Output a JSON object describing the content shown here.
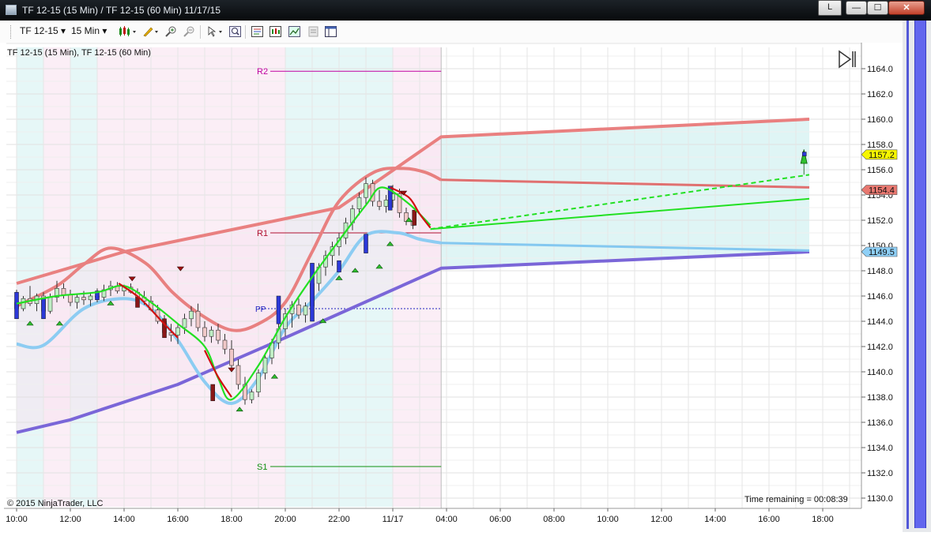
{
  "window": {
    "title": "TF 12-15 (15 Min) / TF 12-15 (60 Min)  11/17/15",
    "layout_button": "L",
    "minimize": "—",
    "maximize": "☐",
    "close": "✕"
  },
  "toolbar": {
    "instrument": "TF 12-15",
    "interval": "15 Min",
    "icons": [
      "candlestick-chart-icon",
      "pencil-icon",
      "zoom-in-icon",
      "zoom-out-icon",
      "cursor-icon",
      "magnify-icon",
      "data-box-icon",
      "indicators-icon",
      "strategies-icon",
      "properties-icon",
      "panel-icon"
    ]
  },
  "chart": {
    "label": "TF 12-15 (15 Min), TF 12-15 (60 Min)",
    "copyright": "© 2015 NinjaTrader, LLC",
    "time_remaining": "Time remaining = 00:08:39",
    "end_icon": "skip-to-end-icon"
  },
  "chart_data": {
    "type": "candlestick",
    "ylim": [
      1129,
      1166
    ],
    "y_ticks": [
      "1130.0",
      "1132.0",
      "1134.0",
      "1136.0",
      "1138.0",
      "1140.0",
      "1142.0",
      "1144.0",
      "1146.0",
      "1148.0",
      "1150.0",
      "1152.0",
      "1154.0",
      "1156.0",
      "1158.0",
      "1160.0",
      "1162.0",
      "1164.0"
    ],
    "x_ticks": [
      "10:00",
      "12:00",
      "14:00",
      "16:00",
      "18:00",
      "20:00",
      "22:00",
      "11/17",
      "04:00",
      "06:00",
      "08:00",
      "10:00",
      "12:00",
      "14:00",
      "16:00",
      "18:00"
    ],
    "price_tags": [
      {
        "value": 1157.2,
        "label": "1157.2",
        "color": "#f6f600"
      },
      {
        "value": 1154.4,
        "label": "1154.4",
        "color": "#e87870"
      },
      {
        "value": 1149.5,
        "label": "1149.5",
        "color": "#8ecff6"
      }
    ],
    "pivots": [
      {
        "name": "R2",
        "value": 1163.8,
        "color": "#c000a0"
      },
      {
        "name": "R1",
        "value": 1151.0,
        "color": "#b01030"
      },
      {
        "name": "PP",
        "value": 1145.0,
        "color": "#2020c0"
      },
      {
        "name": "S1",
        "value": 1132.5,
        "color": "#109010"
      }
    ],
    "candles_ohlc": [
      [
        1145.5,
        1146.5,
        1144.5,
        1145.0
      ],
      [
        1145.0,
        1146.0,
        1144.8,
        1145.8
      ],
      [
        1145.8,
        1146.8,
        1145.2,
        1145.4
      ],
      [
        1145.4,
        1146.2,
        1144.8,
        1146.0
      ],
      [
        1146.0,
        1146.3,
        1144.5,
        1144.8
      ],
      [
        1144.8,
        1146.2,
        1144.6,
        1145.9
      ],
      [
        1145.9,
        1147.2,
        1145.5,
        1146.6
      ],
      [
        1146.6,
        1147.0,
        1145.8,
        1146.1
      ],
      [
        1146.1,
        1146.5,
        1145.2,
        1145.5
      ],
      [
        1145.5,
        1146.2,
        1145.0,
        1145.9
      ],
      [
        1145.9,
        1146.4,
        1145.3,
        1145.7
      ],
      [
        1145.7,
        1146.3,
        1145.2,
        1146.0
      ],
      [
        1146.0,
        1146.6,
        1145.5,
        1145.9
      ],
      [
        1145.9,
        1146.9,
        1145.6,
        1146.5
      ],
      [
        1146.5,
        1147.2,
        1146.0,
        1146.8
      ],
      [
        1146.8,
        1147.1,
        1146.2,
        1146.4
      ],
      [
        1146.4,
        1146.9,
        1146.0,
        1146.7
      ],
      [
        1146.7,
        1147.0,
        1146.2,
        1146.3
      ],
      [
        1146.3,
        1146.6,
        1145.7,
        1145.9
      ],
      [
        1145.9,
        1146.4,
        1145.3,
        1145.6
      ],
      [
        1145.6,
        1146.0,
        1144.8,
        1144.9
      ],
      [
        1144.9,
        1145.3,
        1143.8,
        1144.0
      ],
      [
        1144.0,
        1144.5,
        1142.8,
        1143.1
      ],
      [
        1143.1,
        1143.8,
        1142.4,
        1142.9
      ],
      [
        1142.9,
        1143.8,
        1142.2,
        1143.5
      ],
      [
        1143.5,
        1144.6,
        1143.0,
        1144.2
      ],
      [
        1144.2,
        1145.2,
        1143.6,
        1144.8
      ],
      [
        1144.8,
        1145.4,
        1143.2,
        1143.5
      ],
      [
        1143.5,
        1144.0,
        1142.4,
        1142.8
      ],
      [
        1142.8,
        1143.6,
        1142.3,
        1143.3
      ],
      [
        1143.3,
        1143.8,
        1142.2,
        1142.5
      ],
      [
        1142.5,
        1143.0,
        1141.4,
        1141.8
      ],
      [
        1141.8,
        1142.5,
        1140.2,
        1140.5
      ],
      [
        1140.5,
        1141.0,
        1138.6,
        1139.0
      ],
      [
        1139.0,
        1139.6,
        1137.4,
        1137.8
      ],
      [
        1137.8,
        1138.6,
        1137.5,
        1138.4
      ],
      [
        1138.4,
        1140.2,
        1138.0,
        1139.9
      ],
      [
        1139.9,
        1141.4,
        1139.4,
        1141.1
      ],
      [
        1141.1,
        1142.6,
        1140.6,
        1142.3
      ],
      [
        1142.3,
        1143.8,
        1141.8,
        1143.4
      ],
      [
        1143.4,
        1145.0,
        1142.8,
        1144.6
      ],
      [
        1144.6,
        1145.6,
        1143.5,
        1145.3
      ],
      [
        1145.3,
        1145.8,
        1144.2,
        1144.5
      ],
      [
        1144.5,
        1145.5,
        1143.9,
        1145.2
      ],
      [
        1145.2,
        1147.5,
        1144.0,
        1147.0
      ],
      [
        1147.0,
        1148.6,
        1146.4,
        1148.3
      ],
      [
        1148.3,
        1149.6,
        1147.6,
        1149.2
      ],
      [
        1149.2,
        1150.3,
        1148.4,
        1149.9
      ],
      [
        1149.9,
        1151.0,
        1149.2,
        1150.6
      ],
      [
        1150.6,
        1152.2,
        1150.1,
        1151.8
      ],
      [
        1151.8,
        1153.2,
        1151.2,
        1152.9
      ],
      [
        1152.9,
        1154.2,
        1152.4,
        1153.8
      ],
      [
        1153.8,
        1155.4,
        1153.2,
        1154.9
      ],
      [
        1154.9,
        1155.2,
        1153.1,
        1153.5
      ],
      [
        1153.5,
        1154.4,
        1152.8,
        1153.1
      ],
      [
        1153.1,
        1154.0,
        1152.6,
        1153.6
      ],
      [
        1153.6,
        1154.8,
        1153.0,
        1154.1
      ],
      [
        1154.1,
        1154.5,
        1152.2,
        1152.6
      ],
      [
        1152.6,
        1153.0,
        1151.6,
        1151.9
      ],
      [
        1151.9,
        1152.3,
        1151.3,
        1151.6
      ]
    ],
    "upper_band": [
      [
        1140.0,
        1147.0
      ],
      [
        1144.0,
        1149.5
      ],
      [
        1152.0,
        1153.0
      ],
      [
        1155.8,
        1158.6
      ],
      [
        1169.5,
        1160.0
      ]
    ],
    "lower_band": [
      [
        1140.0,
        1135.2
      ],
      [
        1142.0,
        1136.2
      ],
      [
        1146.0,
        1139.0
      ],
      [
        1150.0,
        1142.7
      ],
      [
        1155.8,
        1148.2
      ],
      [
        1169.5,
        1149.5
      ]
    ],
    "upper_median": [
      [
        1155.8,
        1155.2
      ],
      [
        1169.5,
        1154.6
      ]
    ],
    "lower_median": [
      [
        1155.8,
        1150.2
      ],
      [
        1169.5,
        1149.6
      ]
    ],
    "cyan_curve": [
      [
        1140.0,
        1142.2
      ],
      [
        1141.0,
        1142.1
      ],
      [
        1142.5,
        1145.0
      ],
      [
        1144.0,
        1145.8
      ],
      [
        1145.0,
        1145.0
      ],
      [
        1146.0,
        1142.5
      ],
      [
        1147.0,
        1139.2
      ],
      [
        1148.0,
        1137.5
      ],
      [
        1149.0,
        1139.5
      ],
      [
        1150.0,
        1143.5
      ],
      [
        1151.0,
        1145.6
      ],
      [
        1152.0,
        1148.0
      ],
      [
        1153.0,
        1150.8
      ],
      [
        1154.2,
        1151.0
      ],
      [
        1155.0,
        1150.5
      ],
      [
        1155.8,
        1150.2
      ]
    ],
    "pink_curve": [
      [
        1140.0,
        1145.2
      ],
      [
        1141.5,
        1146.8
      ],
      [
        1142.5,
        1148.5
      ],
      [
        1143.5,
        1149.8
      ],
      [
        1144.8,
        1148.6
      ],
      [
        1145.8,
        1146.3
      ],
      [
        1146.8,
        1144.6
      ],
      [
        1148.0,
        1143.3
      ],
      [
        1149.0,
        1143.8
      ],
      [
        1150.0,
        1145.5
      ],
      [
        1151.0,
        1149.5
      ],
      [
        1152.0,
        1153.5
      ],
      [
        1153.3,
        1155.8
      ],
      [
        1154.4,
        1156.1
      ],
      [
        1155.2,
        1155.8
      ],
      [
        1155.8,
        1155.2
      ]
    ],
    "green_ma": [
      [
        1140.0,
        1145.4
      ],
      [
        1141.5,
        1146.0
      ],
      [
        1143.0,
        1146.3
      ],
      [
        1144.0,
        1146.8
      ],
      [
        1145.0,
        1145.5
      ],
      [
        1146.0,
        1143.8
      ],
      [
        1147.0,
        1142.0
      ],
      [
        1147.5,
        1139.5
      ],
      [
        1148.0,
        1137.8
      ],
      [
        1149.0,
        1140.5
      ],
      [
        1150.0,
        1144.3
      ],
      [
        1151.0,
        1147.5
      ],
      [
        1152.0,
        1150.4
      ],
      [
        1153.0,
        1153.2
      ],
      [
        1153.6,
        1154.6
      ],
      [
        1154.6,
        1153.3
      ],
      [
        1155.4,
        1151.6
      ]
    ],
    "red_ma_segments": [
      [
        [
          1143.8,
          1147.0
        ],
        [
          1144.6,
          1145.8
        ],
        [
          1145.4,
          1144.0
        ],
        [
          1146.0,
          1142.7
        ]
      ],
      [
        [
          1147.0,
          1141.7
        ],
        [
          1147.5,
          1139.6
        ],
        [
          1148.0,
          1138.0
        ]
      ],
      [
        [
          1153.9,
          1154.6
        ],
        [
          1154.6,
          1153.8
        ],
        [
          1155.0,
          1152.5
        ],
        [
          1155.4,
          1151.4
        ]
      ]
    ],
    "forecast_solid": [
      [
        1155.4,
        1151.3
      ],
      [
        1169.5,
        1153.7
      ]
    ],
    "forecast_dashed": [
      [
        1155.4,
        1151.3
      ],
      [
        1169.5,
        1155.6
      ]
    ],
    "signals": {
      "up": [
        [
          1140.5,
          1144.0
        ],
        [
          1141.6,
          1144.0
        ],
        [
          1143.5,
          1145.6
        ],
        [
          1148.3,
          1137.2
        ],
        [
          1149.6,
          1139.8
        ],
        [
          1151.4,
          1144.2
        ],
        [
          1152.0,
          1147.6
        ],
        [
          1152.6,
          1148.2
        ],
        [
          1153.5,
          1148.5
        ],
        [
          1153.9,
          1150.3
        ],
        [
          1154.6,
          1152.2
        ]
      ],
      "down": [
        [
          1144.3,
          1147.2
        ],
        [
          1146.1,
          1148.0
        ],
        [
          1154.4,
          1154.0
        ],
        [
          1148.0,
          1140.0
        ]
      ]
    }
  }
}
